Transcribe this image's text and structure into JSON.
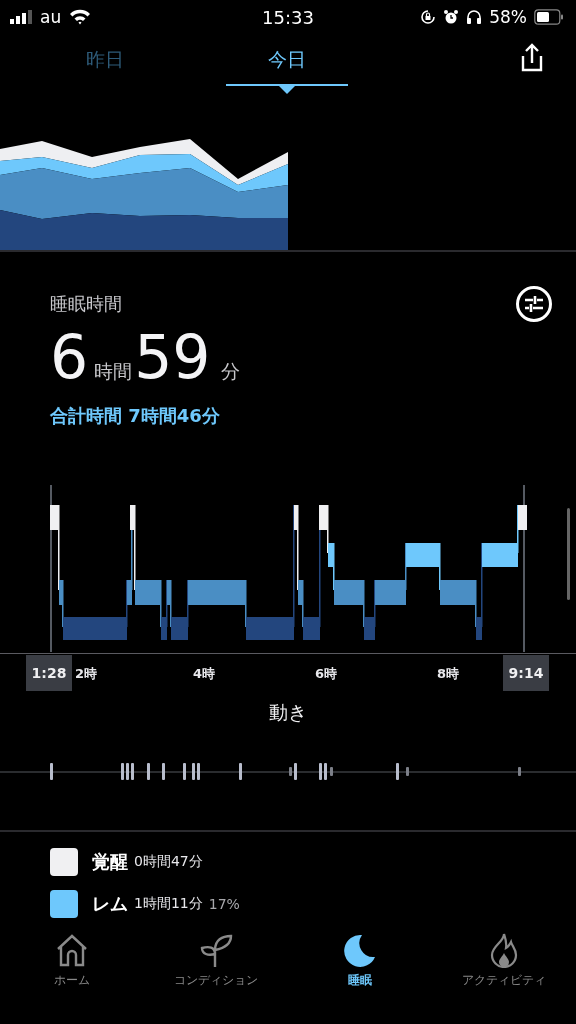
{
  "status_bar": {
    "carrier": "au",
    "time": "15:33",
    "battery": "58%"
  },
  "tabs": [
    {
      "label": "昨日",
      "selected": false
    },
    {
      "label": "今日",
      "selected": true
    }
  ],
  "sleep": {
    "title": "睡眠時間",
    "hours": "6",
    "hours_unit": "時間",
    "minutes": "59",
    "minutes_unit": "分",
    "total": "合計時間 7時間46分"
  },
  "hypnogram": {
    "start": "1:28",
    "end": "9:14",
    "ticks": [
      "2時",
      "4時",
      "6時",
      "8時"
    ]
  },
  "movement": {
    "title": "動き"
  },
  "legend": [
    {
      "name": "覚醒",
      "duration": "0時間47分",
      "color": "#f0f0f2"
    },
    {
      "name": "レム",
      "duration": "1時間11分",
      "percent": "17%",
      "color": "#6ec8fc"
    }
  ],
  "nav": [
    {
      "kind": "home",
      "label": "ホーム",
      "selected": false
    },
    {
      "kind": "condition",
      "label": "コンディション",
      "selected": false
    },
    {
      "kind": "sleep",
      "label": "睡眠",
      "selected": true
    },
    {
      "kind": "activity",
      "label": "アクティビティ",
      "selected": false
    }
  ]
}
